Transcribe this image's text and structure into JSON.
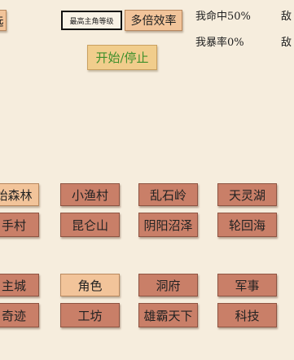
{
  "top": {
    "cut_label": "选",
    "max_level_button": "最高主角等级",
    "multi_efficiency_button": "多倍效率",
    "start_stop_button": "开始/停止",
    "my_hit_rate": "我命中50%",
    "my_crit_rate": "我暴率0%",
    "enemy_label_1": "敌",
    "enemy_label_2": "敌"
  },
  "maps": {
    "row1": [
      "始森林",
      "小渔村",
      "乱石岭",
      "天灵湖"
    ],
    "row2": [
      "手村",
      "昆仑山",
      "阴阳沼泽",
      "轮回海"
    ]
  },
  "menu": {
    "row1": [
      "主城",
      "角色",
      "洞府",
      "军事"
    ],
    "row2": [
      "奇迹",
      "工坊",
      "雄霸天下",
      "科技"
    ]
  }
}
